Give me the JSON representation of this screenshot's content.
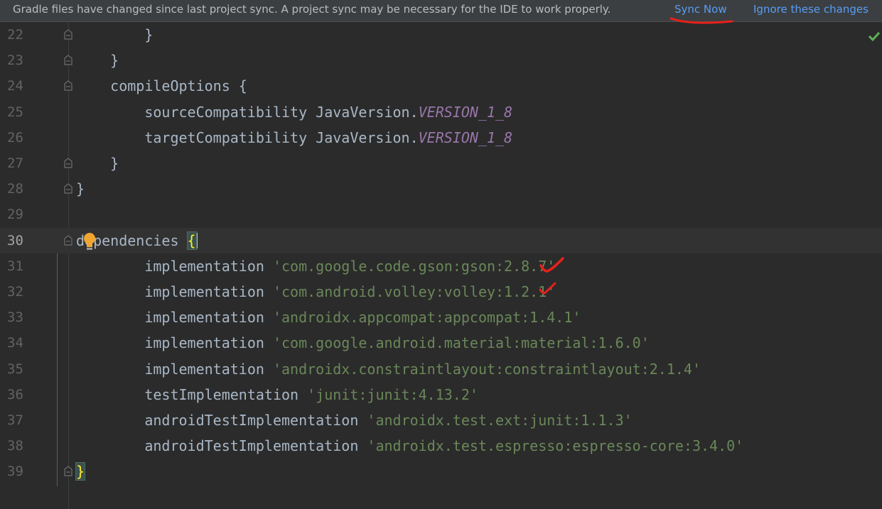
{
  "banner": {
    "message": "Gradle files have changed since last project sync. A project sync may be necessary for the IDE to work properly.",
    "sync_now": "Sync Now",
    "ignore": "Ignore these changes"
  },
  "editor": {
    "current_line": "30",
    "lines": [
      {
        "num": "22",
        "indent": "        ",
        "tokens": [
          {
            "t": "}",
            "c": "kw"
          }
        ]
      },
      {
        "num": "23",
        "indent": "    ",
        "tokens": [
          {
            "t": "}",
            "c": "kw"
          }
        ]
      },
      {
        "num": "24",
        "indent": "    ",
        "tokens": [
          {
            "t": "compileOptions {",
            "c": "kw"
          }
        ]
      },
      {
        "num": "25",
        "indent": "        ",
        "tokens": [
          {
            "t": "sourceCompatibility JavaVersion.",
            "c": "kw"
          },
          {
            "t": "VERSION_1_8",
            "c": "const"
          }
        ]
      },
      {
        "num": "26",
        "indent": "        ",
        "tokens": [
          {
            "t": "targetCompatibility JavaVersion.",
            "c": "kw"
          },
          {
            "t": "VERSION_1_8",
            "c": "const"
          }
        ]
      },
      {
        "num": "27",
        "indent": "    ",
        "tokens": [
          {
            "t": "}",
            "c": "kw"
          }
        ]
      },
      {
        "num": "28",
        "indent": "",
        "tokens": [
          {
            "t": "}",
            "c": "kw"
          }
        ]
      },
      {
        "num": "29",
        "indent": "",
        "tokens": []
      },
      {
        "num": "30",
        "indent": "",
        "tokens": [
          {
            "t": "dependencies ",
            "c": "kw"
          },
          {
            "t": "{",
            "c": "brace"
          }
        ]
      },
      {
        "num": "31",
        "indent": "        ",
        "tokens": [
          {
            "t": "implementation ",
            "c": "kw"
          },
          {
            "t": "'com.google.code.gson:gson:2.8.7'",
            "c": "str"
          }
        ]
      },
      {
        "num": "32",
        "indent": "        ",
        "tokens": [
          {
            "t": "implementation ",
            "c": "kw"
          },
          {
            "t": "'com.android.volley:volley:1.2.1'",
            "c": "str"
          }
        ]
      },
      {
        "num": "33",
        "indent": "        ",
        "tokens": [
          {
            "t": "implementation ",
            "c": "kw"
          },
          {
            "t": "'androidx.appcompat:appcompat:1.4.1'",
            "c": "str"
          }
        ]
      },
      {
        "num": "34",
        "indent": "        ",
        "tokens": [
          {
            "t": "implementation ",
            "c": "kw"
          },
          {
            "t": "'com.google.android.material:material:1.6.0'",
            "c": "str"
          }
        ]
      },
      {
        "num": "35",
        "indent": "        ",
        "tokens": [
          {
            "t": "implementation ",
            "c": "kw"
          },
          {
            "t": "'androidx.constraintlayout:constraintlayout:2.1.4'",
            "c": "str"
          }
        ]
      },
      {
        "num": "36",
        "indent": "        ",
        "tokens": [
          {
            "t": "testImplementation ",
            "c": "kw"
          },
          {
            "t": "'junit:junit:4.13.2'",
            "c": "str"
          }
        ]
      },
      {
        "num": "37",
        "indent": "        ",
        "tokens": [
          {
            "t": "androidTestImplementation ",
            "c": "kw"
          },
          {
            "t": "'androidx.test.ext:junit:1.1.3'",
            "c": "str"
          }
        ]
      },
      {
        "num": "38",
        "indent": "        ",
        "tokens": [
          {
            "t": "androidTestImplementation ",
            "c": "kw"
          },
          {
            "t": "'androidx.test.espresso:espresso-core:3.4.0'",
            "c": "str"
          }
        ]
      },
      {
        "num": "39",
        "indent": "",
        "tokens": [
          {
            "t": "}",
            "c": "brace"
          }
        ]
      }
    ]
  },
  "icons": {
    "fold_marker": "fold-icon",
    "intention": "lightbulb-icon",
    "inspection_ok": "checkmark-icon"
  },
  "colors": {
    "background": "#2b2b2b",
    "banner_bg": "#3c3f41",
    "link": "#589df6",
    "string": "#6a8759",
    "constant": "#9876aa",
    "annotation_red": "#e8211a"
  }
}
